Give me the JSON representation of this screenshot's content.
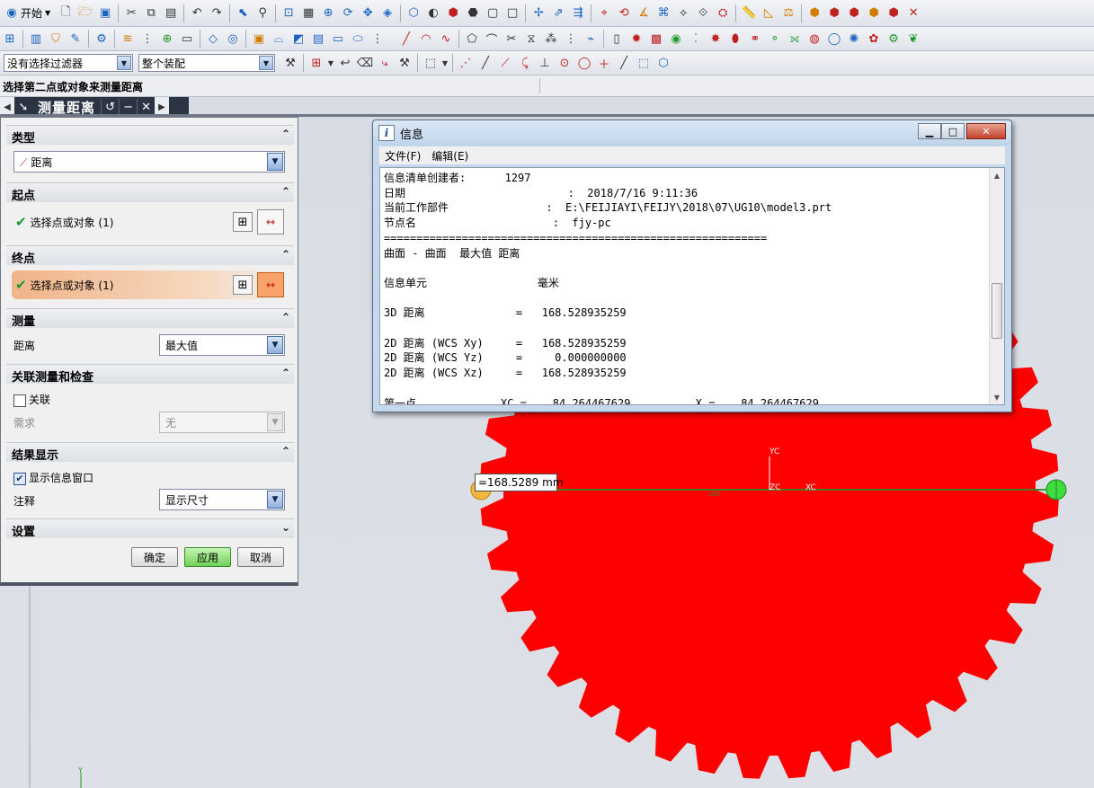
{
  "toolbar": {
    "start_label": "开始",
    "selection_filter": "没有选择过滤器",
    "assembly_scope": "整个装配"
  },
  "prompt": "选择第二点或对象来测量距离",
  "dialog": {
    "title": "测量距离",
    "sections": {
      "type": "类型",
      "start": "起点",
      "end": "终点",
      "measure": "测量",
      "assoc": "关联测量和检查",
      "results": "结果显示",
      "settings": "设置"
    },
    "type_value": "距离",
    "start_select": "选择点或对象 (1)",
    "end_select": "选择点或对象 (1)",
    "distance_label": "距离",
    "distance_value": "最大值",
    "associative_label": "关联",
    "requirement_label": "需求",
    "requirement_value": "无",
    "show_info_label": "显示信息窗口",
    "annotation_label": "注释",
    "annotation_value": "显示尺寸",
    "buttons": {
      "ok": "确定",
      "apply": "应用",
      "cancel": "取消"
    }
  },
  "info_window": {
    "title": "信息",
    "menu": [
      "文件(F)",
      "编辑(E)"
    ],
    "lines": [
      "信息清单创建者:      1297",
      "日期                         :  2018/7/16 9:11:36",
      "当前工作部件               :  E:\\FEIJIAYI\\FEIJY\\2018\\07\\UG10\\model3.prt",
      "节点名                     :  fjy-pc",
      "===========================================================",
      "曲面 - 曲面  最大值 距离",
      "",
      "信息单元                 毫米",
      "",
      "3D 距离              =   168.528935259",
      "",
      "2D 距离 (WCS Xy)     =   168.528935259",
      "2D 距离 (WCS Yz)     =     0.000000000",
      "2D 距离 (WCS Xz)     =   168.528935259",
      "",
      "第一点             XC =    84.264467629          X =    84.264467629"
    ]
  },
  "measurement": {
    "label": "=168.5289 mm",
    "dim_text": "100",
    "axis_yc": "YC",
    "axis_zc": "ZC",
    "axis_xc": "XC",
    "corner_axis": "Y"
  },
  "colors": {
    "gear": "#ff0000",
    "measure_line": "#2e8b2e",
    "active_row": "#f1b489"
  },
  "gear": {
    "teeth": 40
  }
}
